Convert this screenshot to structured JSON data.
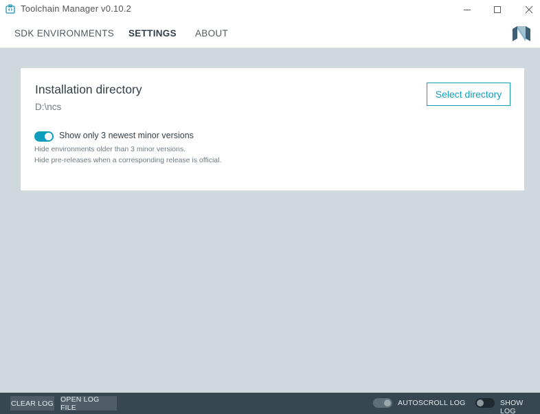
{
  "window": {
    "title": "Toolchain Manager v0.10.2",
    "icon": "toolchain-app-icon",
    "controls": [
      "minimize-icon",
      "maximize-icon",
      "close-icon"
    ]
  },
  "nav": {
    "tabs": [
      {
        "label": "SDK ENVIRONMENTS",
        "active": false
      },
      {
        "label": "SETTINGS",
        "active": true
      },
      {
        "label": "ABOUT",
        "active": false
      }
    ],
    "logo": "nordic-logo-icon"
  },
  "settings": {
    "install_title": "Installation directory",
    "install_path": "D:\\ncs",
    "select_button": "Select directory",
    "toggle_label": "Show only 3 newest minor versions",
    "toggle_on": true,
    "hint_line1": "Hide environments older than 3 minor versions.",
    "hint_line2": "Hide pre-releases when a corresponding release is official."
  },
  "logbar": {
    "clear_log": "CLEAR LOG",
    "open_log_file": "OPEN LOG FILE",
    "autoscroll_label": "AUTOSCROLL LOG",
    "autoscroll_on": true,
    "show_log_label": "SHOW LOG",
    "show_log_on": false
  },
  "colors": {
    "accent": "#0f9dbd",
    "background": "#cfd8dc",
    "logbar": "#37474f",
    "text_dark": "#333f48"
  }
}
